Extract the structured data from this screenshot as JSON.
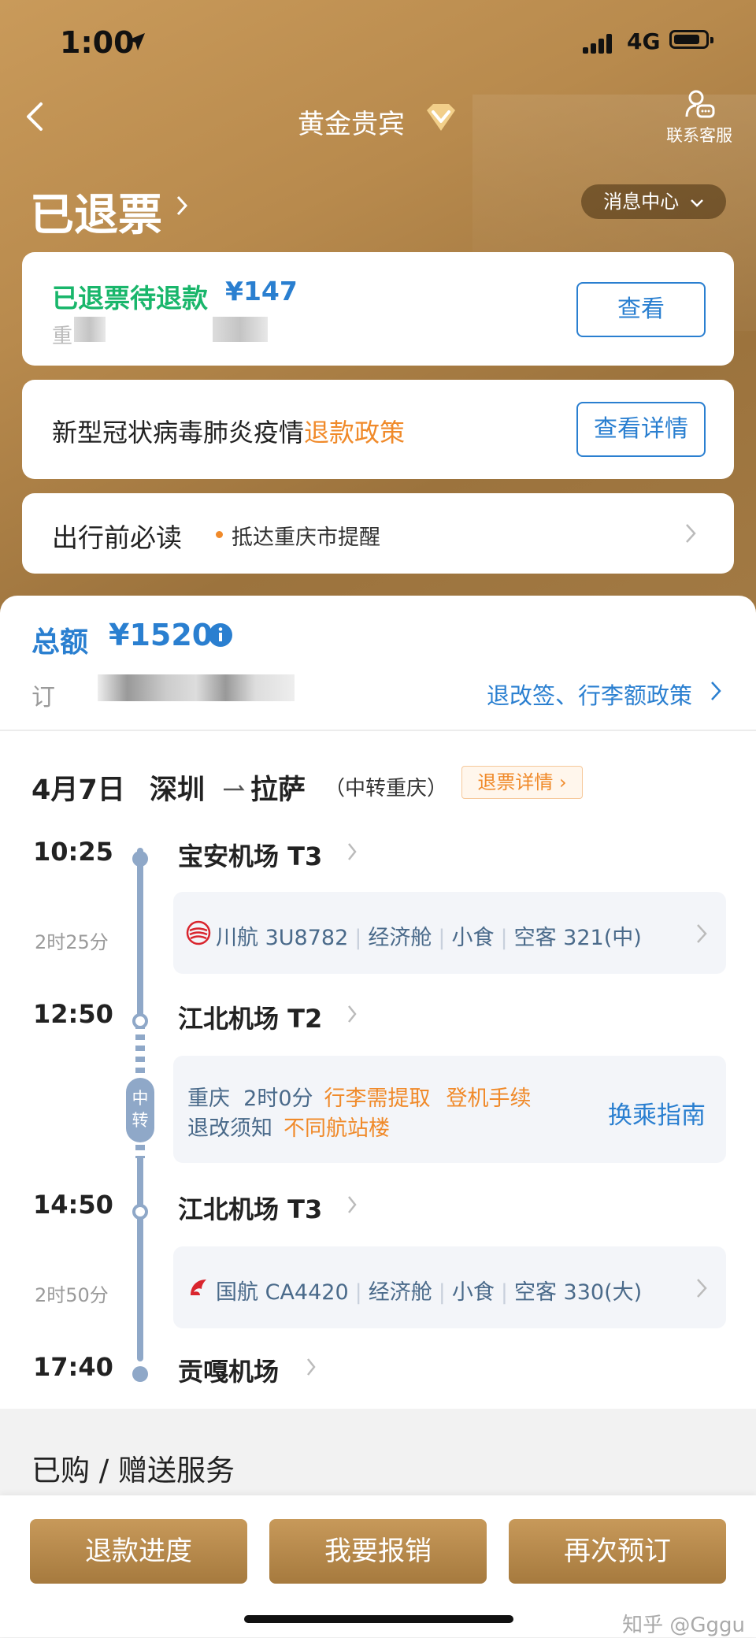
{
  "status_bar": {
    "time": "1:00",
    "network": "4G"
  },
  "nav": {
    "title": "黄金贵宾",
    "customer_service": "联系客服"
  },
  "order_status": {
    "title": "已退票",
    "message_center": "消息中心"
  },
  "refund_card": {
    "label": "已退票待退款",
    "amount": "¥147",
    "blurred_prefix": "重",
    "view_button": "查看"
  },
  "covid_card": {
    "text": "新型冠状病毒肺炎疫情",
    "policy": "退款政策",
    "detail_button": "查看详情"
  },
  "notice_card": {
    "label": "出行前必读",
    "item": "抵达重庆市提醒"
  },
  "summary": {
    "total_label": "总额",
    "total_value": "¥1520",
    "order_prefix": "订",
    "policy_link": "退改签、行李额政策"
  },
  "route": {
    "date": "4月7日",
    "from": "深圳",
    "to": "拉萨",
    "via": "（中转重庆）",
    "refund_tag": "退票详情"
  },
  "timeline": {
    "seg1": {
      "dep_time": "10:25",
      "dep_airport": "宝安机场 T3",
      "duration": "2时25分",
      "airline": "川航",
      "flight_no": "3U8782",
      "cabin": "经济舱",
      "meal": "小食",
      "aircraft": "空客 321(中)",
      "arr_time": "12:50",
      "arr_airport": "江北机场 T2"
    },
    "transfer": {
      "badge": "中转",
      "city": "重庆",
      "wait": "2时0分",
      "baggage": "行李需提取",
      "checkin": "登机手续",
      "rules": "退改须知",
      "terminal": "不同航站楼",
      "guide": "换乘指南"
    },
    "seg2": {
      "dep_time": "14:50",
      "dep_airport": "江北机场 T3",
      "duration": "2时50分",
      "airline": "国航",
      "flight_no": "CA4420",
      "cabin": "经济舱",
      "meal": "小食",
      "aircraft": "空客 330(大)",
      "arr_time": "17:40",
      "arr_airport": "贡嘎机场"
    }
  },
  "services": {
    "title": "已购 / 赠送服务"
  },
  "actions": {
    "refund_progress": "退款进度",
    "reimburse": "我要报销",
    "rebook": "再次预订"
  },
  "watermark": "知乎 @Gggu",
  "colors": {
    "gold": "#b88a4d",
    "blue": "#2a7fd0",
    "orange": "#f08a2a",
    "green": "#19b66b",
    "timeline": "#8fa8c8"
  }
}
